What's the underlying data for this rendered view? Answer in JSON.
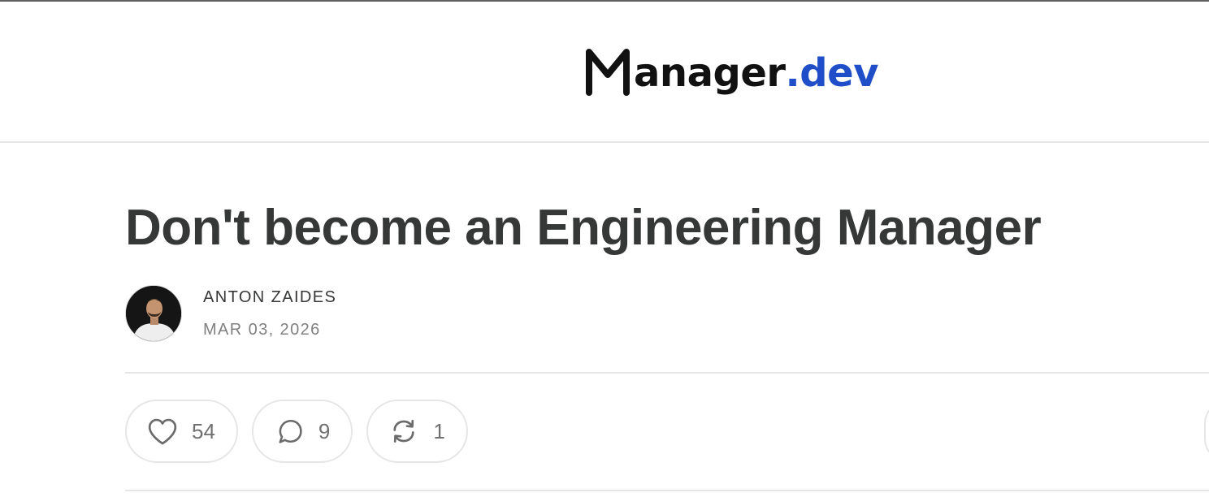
{
  "header": {
    "logo_name": "anager",
    "logo_tld": ".dev",
    "logo_alt": "Manager.dev"
  },
  "post": {
    "title": "Don't become an Engineering Manager",
    "author": "ANTON ZAIDES",
    "date": "MAR 03, 2026"
  },
  "actions": {
    "likes": "54",
    "comments": "9",
    "restacks": "1"
  },
  "icons": {
    "like": "heart-icon",
    "comment": "comment-bubble-icon",
    "restack": "restack-arrows-icon"
  },
  "colors": {
    "title": "#363737",
    "logo_dark": "#111111",
    "logo_accent": "#1f4ec8",
    "muted": "#808080",
    "divider": "#e6e6e6"
  }
}
